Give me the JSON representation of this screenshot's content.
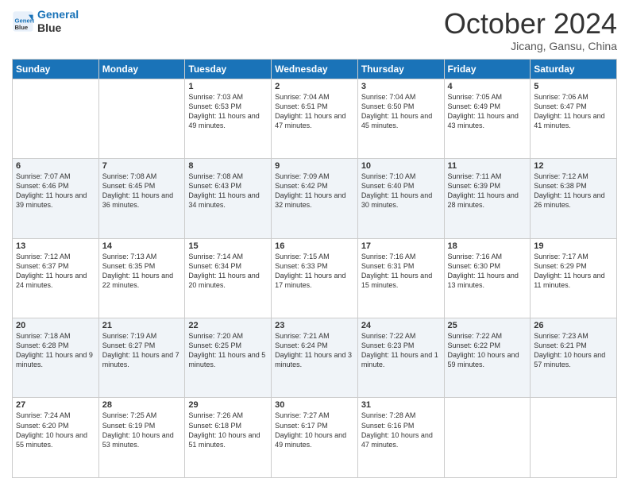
{
  "header": {
    "logo_line1": "General",
    "logo_line2": "Blue",
    "month_title": "October 2024",
    "subtitle": "Jicang, Gansu, China"
  },
  "weekdays": [
    "Sunday",
    "Monday",
    "Tuesday",
    "Wednesday",
    "Thursday",
    "Friday",
    "Saturday"
  ],
  "weeks": [
    [
      {
        "day": "",
        "info": ""
      },
      {
        "day": "",
        "info": ""
      },
      {
        "day": "1",
        "info": "Sunrise: 7:03 AM\nSunset: 6:53 PM\nDaylight: 11 hours and 49 minutes."
      },
      {
        "day": "2",
        "info": "Sunrise: 7:04 AM\nSunset: 6:51 PM\nDaylight: 11 hours and 47 minutes."
      },
      {
        "day": "3",
        "info": "Sunrise: 7:04 AM\nSunset: 6:50 PM\nDaylight: 11 hours and 45 minutes."
      },
      {
        "day": "4",
        "info": "Sunrise: 7:05 AM\nSunset: 6:49 PM\nDaylight: 11 hours and 43 minutes."
      },
      {
        "day": "5",
        "info": "Sunrise: 7:06 AM\nSunset: 6:47 PM\nDaylight: 11 hours and 41 minutes."
      }
    ],
    [
      {
        "day": "6",
        "info": "Sunrise: 7:07 AM\nSunset: 6:46 PM\nDaylight: 11 hours and 39 minutes."
      },
      {
        "day": "7",
        "info": "Sunrise: 7:08 AM\nSunset: 6:45 PM\nDaylight: 11 hours and 36 minutes."
      },
      {
        "day": "8",
        "info": "Sunrise: 7:08 AM\nSunset: 6:43 PM\nDaylight: 11 hours and 34 minutes."
      },
      {
        "day": "9",
        "info": "Sunrise: 7:09 AM\nSunset: 6:42 PM\nDaylight: 11 hours and 32 minutes."
      },
      {
        "day": "10",
        "info": "Sunrise: 7:10 AM\nSunset: 6:40 PM\nDaylight: 11 hours and 30 minutes."
      },
      {
        "day": "11",
        "info": "Sunrise: 7:11 AM\nSunset: 6:39 PM\nDaylight: 11 hours and 28 minutes."
      },
      {
        "day": "12",
        "info": "Sunrise: 7:12 AM\nSunset: 6:38 PM\nDaylight: 11 hours and 26 minutes."
      }
    ],
    [
      {
        "day": "13",
        "info": "Sunrise: 7:12 AM\nSunset: 6:37 PM\nDaylight: 11 hours and 24 minutes."
      },
      {
        "day": "14",
        "info": "Sunrise: 7:13 AM\nSunset: 6:35 PM\nDaylight: 11 hours and 22 minutes."
      },
      {
        "day": "15",
        "info": "Sunrise: 7:14 AM\nSunset: 6:34 PM\nDaylight: 11 hours and 20 minutes."
      },
      {
        "day": "16",
        "info": "Sunrise: 7:15 AM\nSunset: 6:33 PM\nDaylight: 11 hours and 17 minutes."
      },
      {
        "day": "17",
        "info": "Sunrise: 7:16 AM\nSunset: 6:31 PM\nDaylight: 11 hours and 15 minutes."
      },
      {
        "day": "18",
        "info": "Sunrise: 7:16 AM\nSunset: 6:30 PM\nDaylight: 11 hours and 13 minutes."
      },
      {
        "day": "19",
        "info": "Sunrise: 7:17 AM\nSunset: 6:29 PM\nDaylight: 11 hours and 11 minutes."
      }
    ],
    [
      {
        "day": "20",
        "info": "Sunrise: 7:18 AM\nSunset: 6:28 PM\nDaylight: 11 hours and 9 minutes."
      },
      {
        "day": "21",
        "info": "Sunrise: 7:19 AM\nSunset: 6:27 PM\nDaylight: 11 hours and 7 minutes."
      },
      {
        "day": "22",
        "info": "Sunrise: 7:20 AM\nSunset: 6:25 PM\nDaylight: 11 hours and 5 minutes."
      },
      {
        "day": "23",
        "info": "Sunrise: 7:21 AM\nSunset: 6:24 PM\nDaylight: 11 hours and 3 minutes."
      },
      {
        "day": "24",
        "info": "Sunrise: 7:22 AM\nSunset: 6:23 PM\nDaylight: 11 hours and 1 minute."
      },
      {
        "day": "25",
        "info": "Sunrise: 7:22 AM\nSunset: 6:22 PM\nDaylight: 10 hours and 59 minutes."
      },
      {
        "day": "26",
        "info": "Sunrise: 7:23 AM\nSunset: 6:21 PM\nDaylight: 10 hours and 57 minutes."
      }
    ],
    [
      {
        "day": "27",
        "info": "Sunrise: 7:24 AM\nSunset: 6:20 PM\nDaylight: 10 hours and 55 minutes."
      },
      {
        "day": "28",
        "info": "Sunrise: 7:25 AM\nSunset: 6:19 PM\nDaylight: 10 hours and 53 minutes."
      },
      {
        "day": "29",
        "info": "Sunrise: 7:26 AM\nSunset: 6:18 PM\nDaylight: 10 hours and 51 minutes."
      },
      {
        "day": "30",
        "info": "Sunrise: 7:27 AM\nSunset: 6:17 PM\nDaylight: 10 hours and 49 minutes."
      },
      {
        "day": "31",
        "info": "Sunrise: 7:28 AM\nSunset: 6:16 PM\nDaylight: 10 hours and 47 minutes."
      },
      {
        "day": "",
        "info": ""
      },
      {
        "day": "",
        "info": ""
      }
    ]
  ]
}
